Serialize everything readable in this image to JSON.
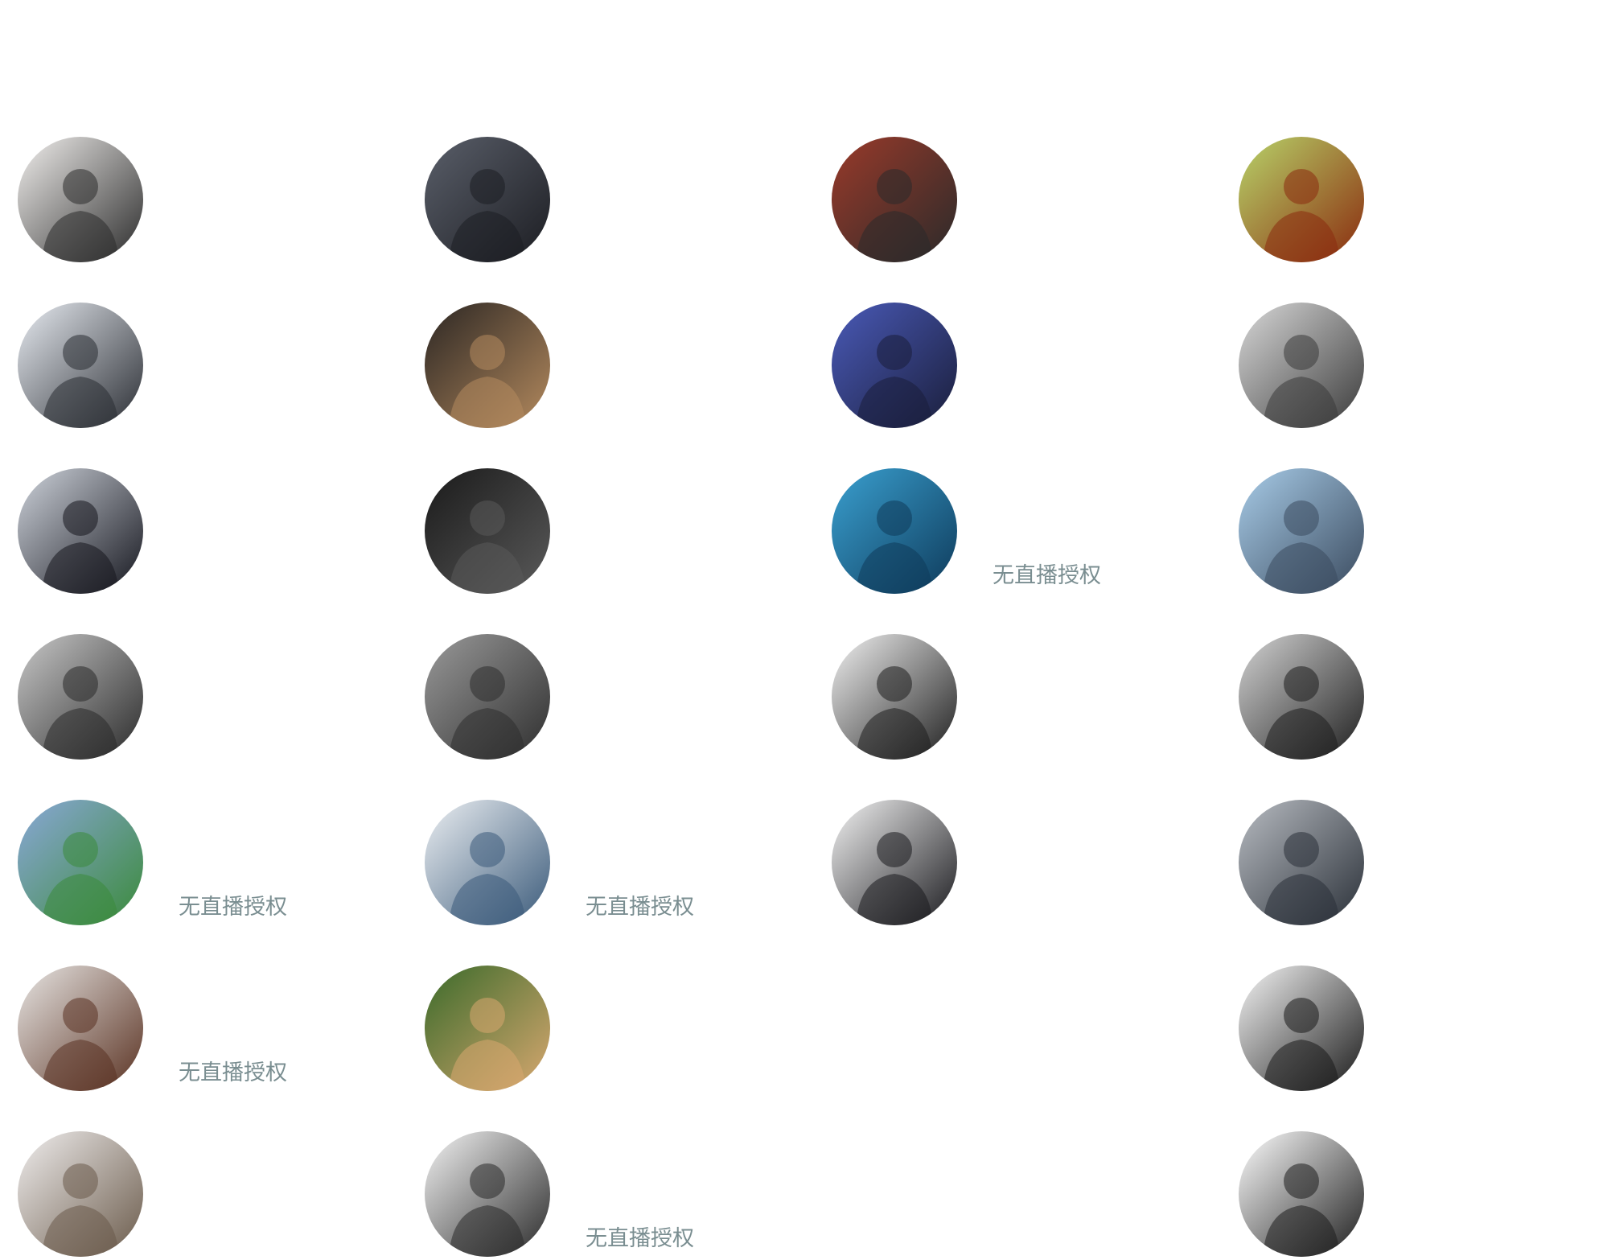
{
  "no_auth_label": "无直播授权",
  "artists": [
    {
      "name": "band-four-men",
      "c1": "#f2f0ee",
      "c2": "#2b2b2b",
      "no_auth": false
    },
    {
      "name": "man-black-shirt",
      "c1": "#5a5f6a",
      "c2": "#1c1d22",
      "no_auth": false
    },
    {
      "name": "split-dj-portrait",
      "c1": "#9a3a2a",
      "c2": "#2a2a2a",
      "no_auth": false
    },
    {
      "name": "anime-illustration",
      "c1": "#b8d46a",
      "c2": "#8a2a0e",
      "no_auth": false
    },
    {
      "name": "band-in-snow",
      "c1": "#e8ecf2",
      "c2": "#2a2d33",
      "no_auth": false
    },
    {
      "name": "man-glasses-striped",
      "c1": "#2b2623",
      "c2": "#b48a5e",
      "no_auth": false
    },
    {
      "name": "dj-blue-lights",
      "c1": "#4a5ab8",
      "c2": "#1a1e3a",
      "no_auth": false
    },
    {
      "name": "woman-bw-piano",
      "c1": "#d9d9d9",
      "c2": "#3a3a3a",
      "no_auth": false
    },
    {
      "name": "woman-dark-hair",
      "c1": "#cfd4dc",
      "c2": "#15161e",
      "no_auth": false
    },
    {
      "name": "man-bw-profile",
      "c1": "#1a1a1a",
      "c2": "#5a5a5a",
      "no_auth": false
    },
    {
      "name": "band-blue-stage",
      "c1": "#3aa0d0",
      "c2": "#0e3a5a",
      "no_auth": true
    },
    {
      "name": "man-nyc-tshirt",
      "c1": "#a8cce8",
      "c2": "#3a4a5e",
      "no_auth": false
    },
    {
      "name": "man-bw-closeup",
      "c1": "#c9c9c9",
      "c2": "#2a2a2a",
      "no_auth": false
    },
    {
      "name": "woman-bw-room",
      "c1": "#9a9a9a",
      "c2": "#2e2e2e",
      "no_auth": false
    },
    {
      "name": "man-dice-headphones",
      "c1": "#f2f2f2",
      "c2": "#1e1e1e",
      "no_auth": false
    },
    {
      "name": "woman-grey-background",
      "c1": "#d4d4d4",
      "c2": "#1e1e1e",
      "no_auth": false
    },
    {
      "name": "group-colorful-garden",
      "c1": "#8aa8d8",
      "c2": "#3a8a3a",
      "no_auth": true
    },
    {
      "name": "man-denim-jacket",
      "c1": "#eceff2",
      "c2": "#3a5a7a",
      "no_auth": true
    },
    {
      "name": "dj-hands-together",
      "c1": "#f4f4f4",
      "c2": "#1a1a1e",
      "no_auth": false
    },
    {
      "name": "band-five-members",
      "c1": "#b8bcc2",
      "c2": "#2a3038",
      "no_auth": false
    },
    {
      "name": "woman-long-hair",
      "c1": "#e8e6e4",
      "c2": "#5a3222",
      "no_auth": true
    },
    {
      "name": "woman-orange-hair-leaves",
      "c1": "#3a6a2a",
      "c2": "#d8a870",
      "no_auth": false
    },
    null,
    {
      "name": "woman-black-dress",
      "c1": "#f6f6f6",
      "c2": "#1a1a1a",
      "no_auth": false
    },
    {
      "name": "woman-updo-hair",
      "c1": "#f0eeee",
      "c2": "#6a5a4a",
      "no_auth": false
    },
    {
      "name": "duo-white-shirts",
      "c1": "#f4f4f4",
      "c2": "#2a2a2a",
      "no_auth": true
    },
    null,
    {
      "name": "duo-dark-hair",
      "c1": "#ffffff",
      "c2": "#1e1e1e",
      "no_auth": false
    }
  ]
}
